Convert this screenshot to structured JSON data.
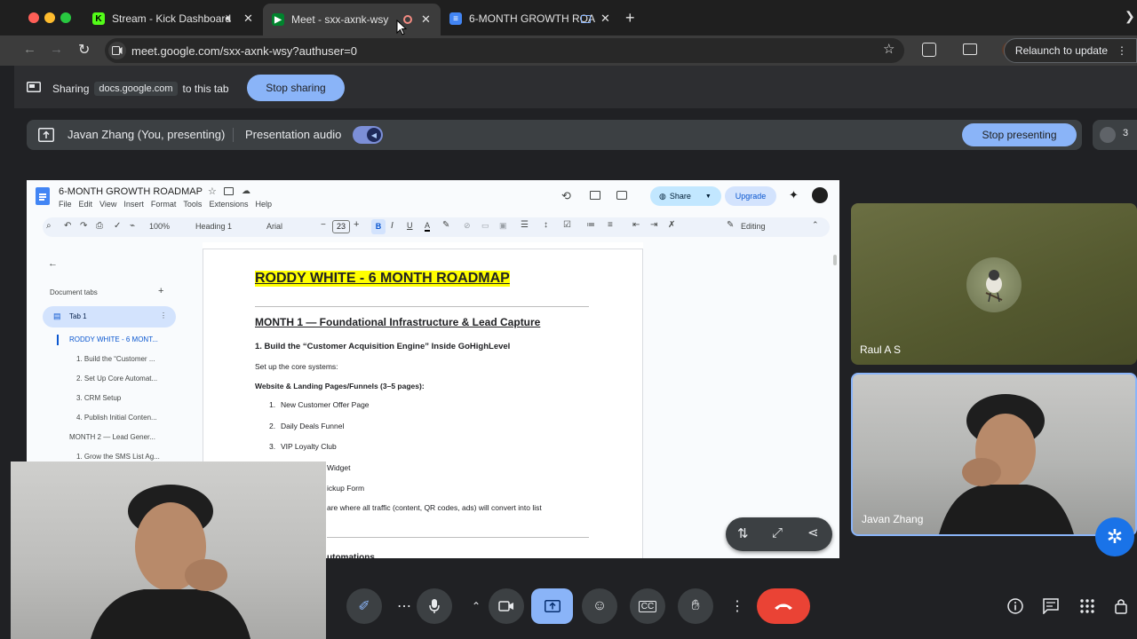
{
  "tabs": [
    {
      "title": "Stream - Kick Dashboard"
    },
    {
      "title": "Meet - sxx-axnk-wsy"
    },
    {
      "title": "6-MONTH GROWTH ROA"
    }
  ],
  "address": {
    "url": "meet.google.com/sxx-axnk-wsy?authuser=0",
    "relaunch_label": "Relaunch to update"
  },
  "share_banner": {
    "prefix": "Sharing",
    "domain": "docs.google.com",
    "suffix": "to this tab",
    "stop_label": "Stop sharing"
  },
  "presenting_bar": {
    "presenter": "Javan Zhang (You, presenting)",
    "audio_label": "Presentation audio",
    "stop_label": "Stop presenting",
    "participant_count": "3"
  },
  "doc": {
    "title": "6-MONTH GROWTH ROADMAP",
    "menu": [
      "File",
      "Edit",
      "View",
      "Insert",
      "Format",
      "Tools",
      "Extensions",
      "Help"
    ],
    "share_label": "Share",
    "upgrade_label": "Upgrade",
    "zoom": "100%",
    "style": "Heading 1",
    "font": "Arial",
    "font_size": "23",
    "mode": "Editing",
    "outline": {
      "header": "Document tabs",
      "tab": "Tab 1",
      "items": [
        "RODDY WHITE - 6 MONT...",
        "1. Build the “Customer ...",
        "2. Set Up Core Automat...",
        "3. CRM Setup",
        "4. Publish Initial Conten...",
        "MONTH 2 — Lead Gener...",
        "1. Grow the SMS List Ag..."
      ]
    },
    "content": {
      "title": "RODDY WHITE - 6 MONTH ROADMAP",
      "month1": "MONTH 1 — Foundational Infrastructure & Lead Capture",
      "section1": "1. Build the “Customer Acquisition Engine” Inside GoHighLevel",
      "setup": "Set up the core systems:",
      "website": "Website & Landing Pages/Funnels (3–5 pages):",
      "list": [
        "New Customer Offer Page",
        "Daily Deals Funnel",
        "VIP Loyalty Club"
      ],
      "partial1": "Widget",
      "partial2": "ickup Form",
      "partial3": "are where all traffic (content, QR codes, ads) will convert into list",
      "partial4": "utomations"
    }
  },
  "participants": [
    {
      "name": "Raul A S"
    },
    {
      "name": "Javan Zhang"
    }
  ],
  "colors": {
    "accent": "#8ab4f8",
    "end_call": "#ea4335",
    "highlight": "#ffff00"
  }
}
